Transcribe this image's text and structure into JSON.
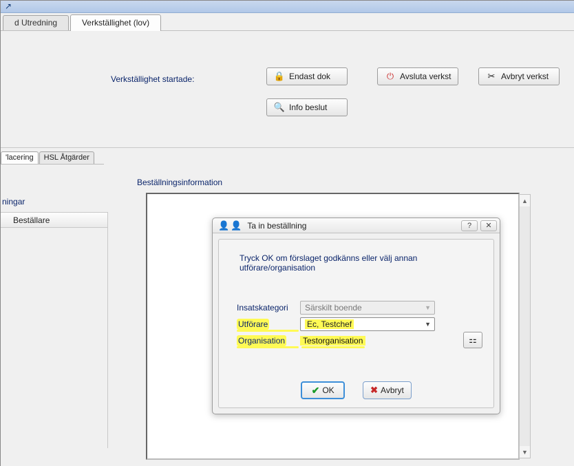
{
  "topbar": {
    "corner": "↗"
  },
  "tabs": {
    "utredning": "d Utredning",
    "verkst": "Verkställighet (lov)"
  },
  "toolbar": {
    "verk_label": "Verkställighet startade:",
    "endast_dok": "Endast dok",
    "avsluta": "Avsluta verkst",
    "avbryt": "Avbryt verkst",
    "info_beslut": "Info beslut"
  },
  "sec_tabs": {
    "placering": "'lacering",
    "hsl": "HSL Åtgärder"
  },
  "main": {
    "bestinfo": "Beställningsinformation",
    "ningar": "ningar",
    "bestallare_hdr": "Beställare"
  },
  "dialog": {
    "title": "Ta in beställning",
    "instruction": "Tryck OK om förslaget godkänns eller välj annan utförare/organisation",
    "insatskategori_lbl": "Insatskategori",
    "insatskategori_val": "Särskilt boende",
    "utforare_lbl": "Utförare",
    "utforare_val": "Ec, Testchef",
    "organisation_lbl": "Organisation",
    "organisation_val": "Testorganisation",
    "ok": "OK",
    "cancel": "Avbryt",
    "help_icon": "?",
    "close_icon": "✕"
  }
}
